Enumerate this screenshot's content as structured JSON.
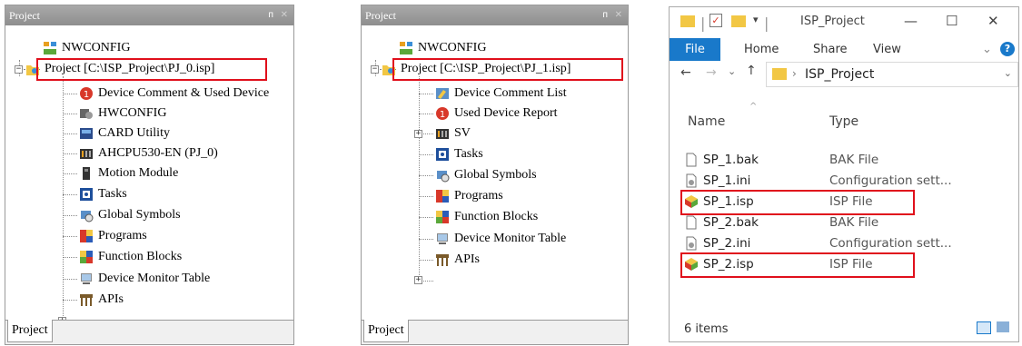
{
  "left_panel": {
    "title": "Project",
    "items": [
      {
        "label": "NWCONFIG",
        "icon": "nwconfig-icon"
      },
      {
        "label": "Project [C:\\ISP_Project\\PJ_0.isp]",
        "icon": "project-icon"
      },
      {
        "label": "Device Comment & Used Device",
        "icon": "device-comment-icon"
      },
      {
        "label": "HWCONFIG",
        "icon": "hwconfig-icon"
      },
      {
        "label": "CARD Utility",
        "icon": "card-utility-icon"
      },
      {
        "label": "AHCPU530-EN  (PJ_0)",
        "icon": "cpu-icon"
      },
      {
        "label": "Motion Module",
        "icon": "motion-module-icon"
      },
      {
        "label": "Tasks",
        "icon": "tasks-icon"
      },
      {
        "label": "Global Symbols",
        "icon": "global-symbols-icon"
      },
      {
        "label": "Programs",
        "icon": "programs-icon"
      },
      {
        "label": "Function Blocks",
        "icon": "function-blocks-icon"
      },
      {
        "label": "Device Monitor Table",
        "icon": "device-monitor-icon"
      },
      {
        "label": "APIs",
        "icon": "apis-icon"
      }
    ],
    "tab": "Project"
  },
  "middle_panel": {
    "title": "Project",
    "items": [
      {
        "label": "NWCONFIG",
        "icon": "nwconfig-icon"
      },
      {
        "label": "Project [C:\\ISP_Project\\PJ_1.isp]",
        "icon": "project-icon"
      },
      {
        "label": "Device Comment List",
        "icon": "device-comment-list-icon"
      },
      {
        "label": "Used Device Report",
        "icon": "used-device-report-icon"
      },
      {
        "label": "SV",
        "icon": "sv-icon"
      },
      {
        "label": "Tasks",
        "icon": "tasks-icon"
      },
      {
        "label": "Global Symbols",
        "icon": "global-symbols-icon"
      },
      {
        "label": "Programs",
        "icon": "programs-icon"
      },
      {
        "label": "Function Blocks",
        "icon": "function-blocks-icon"
      },
      {
        "label": "Device Monitor Table",
        "icon": "device-monitor-icon"
      },
      {
        "label": "APIs",
        "icon": "apis-icon"
      }
    ],
    "tab": "Project"
  },
  "explorer": {
    "title": "ISP_Project",
    "ribbon": {
      "file": "File",
      "home": "Home",
      "share": "Share",
      "view": "View"
    },
    "breadcrumb": "ISP_Project",
    "columns": {
      "name": "Name",
      "type": "Type"
    },
    "files": [
      {
        "name": "SP_1.bak",
        "type": "BAK File",
        "icon": "file-icon"
      },
      {
        "name": "SP_1.ini",
        "type": "Configuration sett...",
        "icon": "config-file-icon"
      },
      {
        "name": "SP_1.isp",
        "type": "ISP File",
        "icon": "isp-file-icon"
      },
      {
        "name": "SP_2.bak",
        "type": "BAK File",
        "icon": "file-icon"
      },
      {
        "name": "SP_2.ini",
        "type": "Configuration sett...",
        "icon": "config-file-icon"
      },
      {
        "name": "SP_2.isp",
        "type": "ISP File",
        "icon": "isp-file-icon"
      }
    ],
    "status": "6 items"
  },
  "colors": {
    "highlight": "#e0101c",
    "accent": "#1979ca"
  }
}
